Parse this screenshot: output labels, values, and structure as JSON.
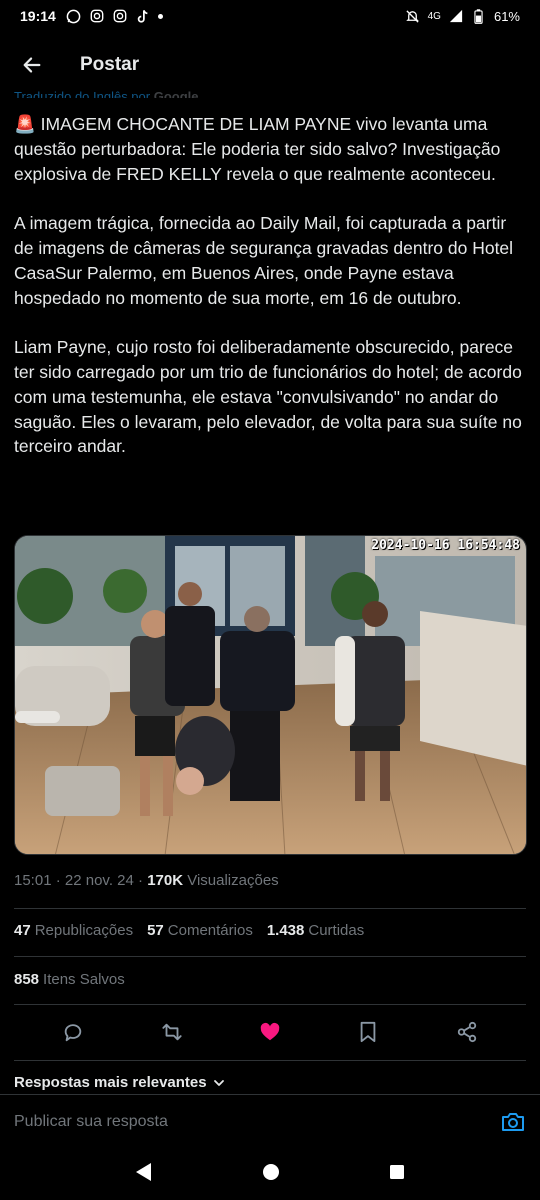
{
  "status": {
    "time": "19:14",
    "network": "4G",
    "battery": "61%"
  },
  "header": {
    "title": "Postar"
  },
  "translation": {
    "text": "Traduzido do Inglês por",
    "provider": "Google"
  },
  "tweet": {
    "paragraphs": [
      "🚨 IMAGEM CHOCANTE DE LIAM PAYNE vivo levanta uma questão perturbadora: Ele poderia ter sido salvo? Investigação explosiva de FRED KELLY revela o que realmente aconteceu.",
      "A imagem trágica, fornecida ao Daily Mail, foi capturada a partir de imagens de câmeras de segurança gravadas dentro do Hotel CasaSur Palermo, em Buenos Aires, onde Payne estava hospedado no momento de sua morte, em 16 de outubro.",
      "Liam Payne, cujo rosto foi deliberadamente obscurecido, parece ter sido carregado por um trio de funcionários do hotel; de acordo com uma testemunha, ele estava \"convulsivando\" no andar do saguão. Eles o levaram, pelo elevador, de volta para sua suíte no terceiro andar."
    ]
  },
  "media": {
    "timestamp": "2024-10-16 16:54:48"
  },
  "meta": {
    "time": "15:01",
    "date": "22 nov. 24",
    "views_count": "170K",
    "views_label": "Visualizações"
  },
  "stats": {
    "reposts_count": "47",
    "reposts_label": "Republicações",
    "comments_count": "57",
    "comments_label": "Comentários",
    "likes_count": "1.438",
    "likes_label": "Curtidas",
    "saves_count": "858",
    "saves_label": "Itens Salvos"
  },
  "replies": {
    "sort_label": "Respostas mais relevantes",
    "placeholder": "Publicar sua resposta"
  },
  "colors": {
    "accent": "#1d9bf0",
    "like": "#f91880",
    "background": "#000000",
    "text": "#e7e9ea",
    "muted": "#71767b"
  }
}
